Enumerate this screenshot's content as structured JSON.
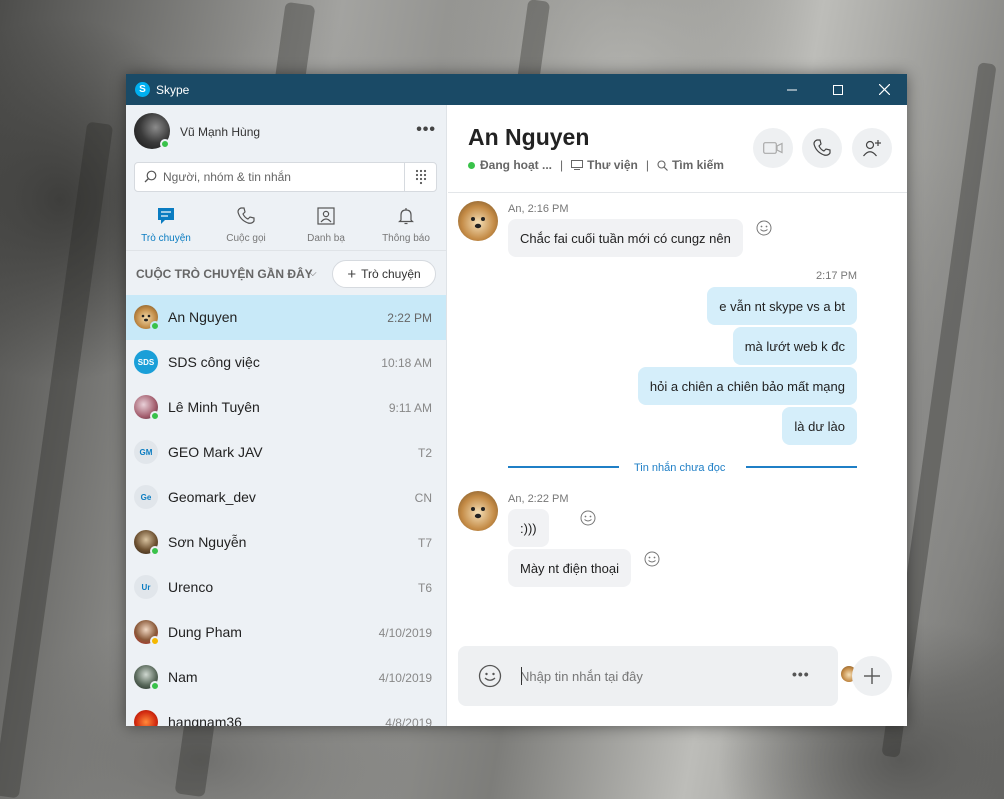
{
  "window": {
    "app_title": "Skype",
    "controls": {
      "minimize": "─",
      "maximize": "☐",
      "close": "✕"
    }
  },
  "profile": {
    "name": "Vũ Mạnh Hùng",
    "more": "•••",
    "status": "online"
  },
  "search": {
    "placeholder": "Người, nhóm & tin nhắn",
    "value": ""
  },
  "nav_tabs": [
    {
      "label": "Trò chuyện",
      "icon": "chat-icon",
      "active": true
    },
    {
      "label": "Cuộc gọi",
      "icon": "phone-icon",
      "active": false
    },
    {
      "label": "Danh bạ",
      "icon": "contacts-icon",
      "active": false
    },
    {
      "label": "Thông báo",
      "icon": "bell-icon",
      "active": false
    }
  ],
  "recent": {
    "title": "CUỘC TRÒ CHUYỆN GẦN ĐÂY",
    "chevron": "⌵",
    "new_chat_label": "Trò chuyện",
    "new_chat_plus": "+"
  },
  "chats": [
    {
      "name": "An Nguyen",
      "time": "2:22 PM",
      "initials": "",
      "presence": "online"
    },
    {
      "name": "SDS công việc",
      "time": "10:18 AM",
      "initials": "SDS",
      "presence": ""
    },
    {
      "name": "Lê Minh Tuyên",
      "time": "9:11 AM",
      "initials": "",
      "presence": "online"
    },
    {
      "name": "GEO Mark JAV",
      "time": "T2",
      "initials": "GM",
      "presence": ""
    },
    {
      "name": "Geomark_dev",
      "time": "CN",
      "initials": "Ge",
      "presence": ""
    },
    {
      "name": "Sơn Nguyễn",
      "time": "T7",
      "initials": "",
      "presence": "online"
    },
    {
      "name": "Urenco",
      "time": "T6",
      "initials": "Ur",
      "presence": ""
    },
    {
      "name": "Dung Pham",
      "time": "4/10/2019",
      "initials": "",
      "presence": "away"
    },
    {
      "name": "Nam",
      "time": "4/10/2019",
      "initials": "",
      "presence": "online"
    },
    {
      "name": "hangnam36",
      "time": "4/8/2019",
      "initials": "",
      "presence": ""
    }
  ],
  "conversation": {
    "title": "An Nguyen",
    "status": "Đang hoạt ...",
    "separator": "|",
    "gallery": "Thư viện",
    "find": "Tìm kiếm",
    "messages": {
      "in1_meta": "An, 2:16 PM",
      "in1_text": "Chắc fai cuối tuần mới có cungz nên",
      "out_meta": "2:17 PM",
      "out": [
        "e vẫn nt skype vs a bt",
        "mà lướt web k đc",
        "hỏi a chiên a chiên bảo mất mạng",
        "là dư lào"
      ],
      "unread": "Tin nhắn chưa đọc",
      "in2_meta": "An, 2:22 PM",
      "in2": [
        ":)))",
        "Mày nt điện thoại"
      ]
    },
    "composer": {
      "placeholder": "Nhập tin nhắn tại đây",
      "more": "•••"
    }
  }
}
